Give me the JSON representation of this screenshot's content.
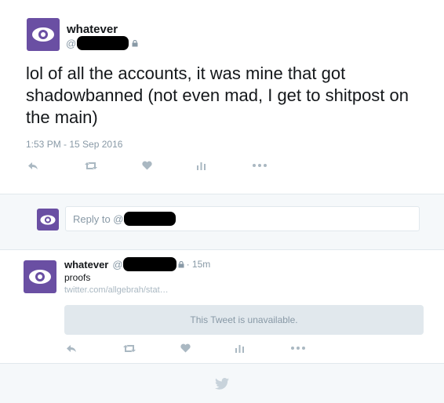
{
  "main_tweet": {
    "display_name": "whatever",
    "handle_prefix": "@",
    "text": "lol of all the accounts, it was mine that got shadowbanned (not even mad, I get to shitpost on the main)",
    "timestamp": "1:53 PM - 15 Sep 2016"
  },
  "reply_box": {
    "placeholder_prefix": "Reply to @"
  },
  "reply_tweet": {
    "display_name": "whatever",
    "handle_prefix": "@",
    "time_ago": "· 15m",
    "text": "proofs",
    "link": "twitter.com/allgebrah/stat…",
    "unavailable": "This Tweet is unavailable."
  },
  "colors": {
    "avatar": "#6a4fa3",
    "muted": "#8899a6",
    "icon": "#aab8c2",
    "footer_bg": "#f5f8fa"
  },
  "icons": [
    "eye-icon",
    "lock-icon",
    "reply-icon",
    "retweet-icon",
    "heart-icon",
    "analytics-icon",
    "more-icon",
    "twitter-bird-icon"
  ]
}
